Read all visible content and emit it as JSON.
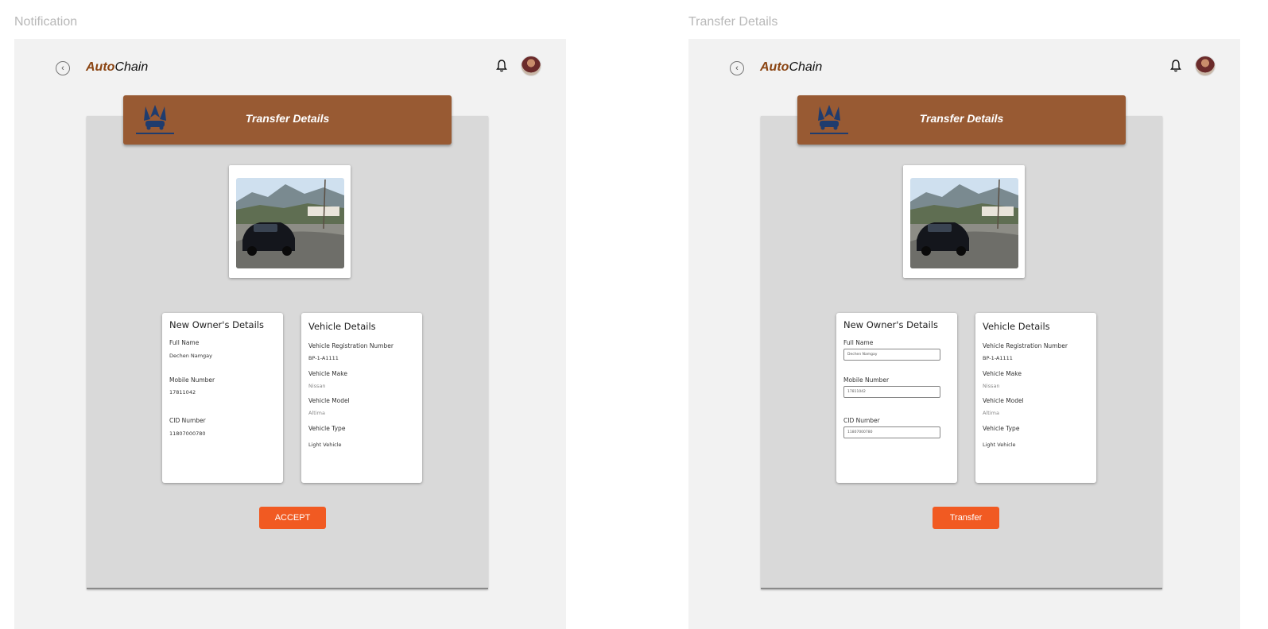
{
  "screens": [
    {
      "frame_label": "Notification",
      "brand": {
        "part1": "Auto",
        "part2": "Chain"
      },
      "banner_title": "Transfer Details",
      "owner_card": {
        "heading": "New Owner's Details",
        "full_name_label": "Full Name",
        "full_name": "Dechen Namgay",
        "mobile_label": "Mobile Number",
        "mobile": "17811042",
        "cid_label": "CID Number",
        "cid": "11807000780"
      },
      "vehicle_card": {
        "heading": "Vehicle Details",
        "reg_label": "Vehicle Registration Number",
        "reg": "BP-1-A1111",
        "make_label": "Vehicle Make",
        "make": "Nissan",
        "model_label": "Vehicle Model",
        "model": "Altima",
        "type_label": "Vehicle Type",
        "type": "Light Vehicle"
      },
      "action_label": "ACCEPT"
    },
    {
      "frame_label": "Transfer Details",
      "brand": {
        "part1": "Auto",
        "part2": "Chain"
      },
      "banner_title": "Transfer Details",
      "owner_card": {
        "heading": "New Owner's Details",
        "full_name_label": "Full Name",
        "full_name": "Dechen Namgay",
        "mobile_label": "Mobile Number",
        "mobile": "17811042",
        "cid_label": "CID Number",
        "cid": "11807000780"
      },
      "vehicle_card": {
        "heading": "Vehicle Details",
        "reg_label": "Vehicle Registration Number",
        "reg": "BP-1-A1111",
        "make_label": "Vehicle Make",
        "make": "Nissan",
        "model_label": "Vehicle Model",
        "model": "Altima",
        "type_label": "Vehicle Type",
        "type": "Light Vehicle"
      },
      "action_label": "Transfer"
    }
  ],
  "colors": {
    "banner": "#985a33",
    "action_button": "#f15a22",
    "brand_accent": "#8b4513",
    "panel": "#d9d9d9",
    "frame": "#f2f2f2"
  },
  "icons": [
    "back-arrow-icon",
    "bell-icon",
    "avatar",
    "autochain-logo",
    "car-photo"
  ]
}
